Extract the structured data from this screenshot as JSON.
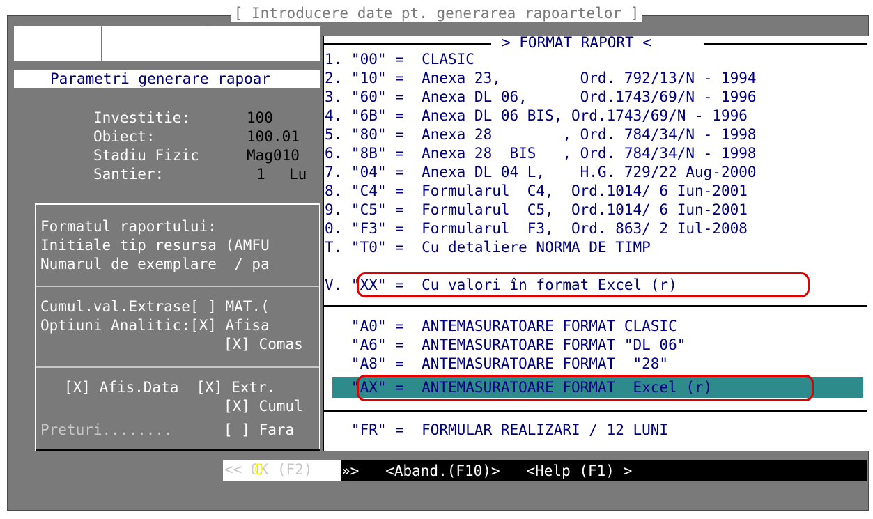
{
  "window": {
    "title": "[ Introducere date pt. generarea rapoartelor ]",
    "subtitle": "Parametri generare rapoar"
  },
  "fields": [
    {
      "label": "Investitie:",
      "value": "100"
    },
    {
      "label": "Obiect:",
      "value": "100.01"
    },
    {
      "label": "Stadiu Fizic",
      "value": "Mag010"
    },
    {
      "label": "Santier:",
      "value": "1",
      "extra": "Lu"
    }
  ],
  "options_panel": {
    "line1": "Formatul raportului:",
    "line2": "Initiale tip resursa (AMFU",
    "line3": "Numarul de exemplare  / pa",
    "cumul": "Cumul.val.Extrase[ ] MAT.(",
    "optiuni1": "Optiuni Analitic:[X] Afisa",
    "optiuni2": "[X] Comas",
    "afis": "[X] Afis.Data  [X] Extr.",
    "cumul2": "[X] Cumul",
    "preturi_label": "Preturi........",
    "preturi_value": "[ ] Fara"
  },
  "buttons": {
    "ok": "<< OK (F2)",
    "ok_hot": "O",
    "rest": "»>   <Aband.(F10)>   <Help (F1) >"
  },
  "popup": {
    "title": "> FORMAT RAPORT <",
    "items": [
      "1. \"00\" =  CLASIC",
      "2. \"10\" =  Anexa 23,         Ord. 792/13/N - 1994",
      "3. \"60\" =  Anexa DL 06,      Ord.1743/69/N - 1996",
      "4. \"6B\" =  Anexa DL 06 BIS, Ord.1743/69/N - 1996",
      "5. \"80\" =  Anexa 28        , Ord. 784/34/N - 1998",
      "6. \"8B\" =  Anexa 28  BIS   , Ord. 784/34/N - 1998",
      "7. \"04\" =  Anexa DL 04 L,    H.G. 729/22 Aug-2000",
      "8. \"C4\" =  Formularul  C4,  Ord.1014/ 6 Iun-2001",
      "9. \"C5\" =  Formularul  C5,  Ord.1014/ 6 Iun-2001",
      "0. \"F3\" =  Formularul  F3,  Ord. 863/ 2 Iul-2008",
      "T. \"T0\" =  Cu detaliere NORMA DE TIMP",
      "V. \"XX\" =  Cu valori în format Excel (r)"
    ],
    "antemas": [
      "   \"A0\" =  ANTEMASURATOARE FORMAT CLASIC",
      "   \"A6\" =  ANTEMASURATOARE FORMAT \"DL 06\"",
      "   \"A8\" =  ANTEMASURATOARE FORMAT  \"28\"",
      "   \"AX\" =  ANTEMASURATOARE FORMAT  Excel (r)"
    ],
    "fr": "   \"FR\" =  FORMULAR REALIZARI / 12 LUNI"
  },
  "colors": {
    "background": "#7a7a7a",
    "popup_text": "#000080",
    "highlight": "#2e8b8b",
    "annotation": "#e00000"
  }
}
